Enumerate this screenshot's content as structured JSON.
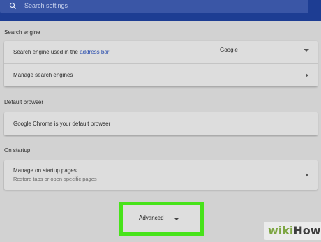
{
  "search": {
    "placeholder": "Search settings"
  },
  "search_engine": {
    "title": "Search engine",
    "used_in_prefix": "Search engine used in the ",
    "used_in_link": "address bar",
    "selected_engine": "Google",
    "manage_label": "Manage search engines"
  },
  "default_browser": {
    "title": "Default browser",
    "status": "Google Chrome is your default browser"
  },
  "on_startup": {
    "title": "On startup",
    "manage_label": "Manage on startup pages",
    "manage_sub": "Restore tabs or open specific pages"
  },
  "advanced": {
    "label": "Advanced"
  },
  "watermark": {
    "wiki": "wiki",
    "how": "How"
  },
  "colors": {
    "header": "#1d3d93",
    "highlight": "#47e31a",
    "link": "#2c4fae"
  },
  "icons": [
    "search-icon",
    "chevron-down-icon",
    "chevron-right-icon"
  ]
}
